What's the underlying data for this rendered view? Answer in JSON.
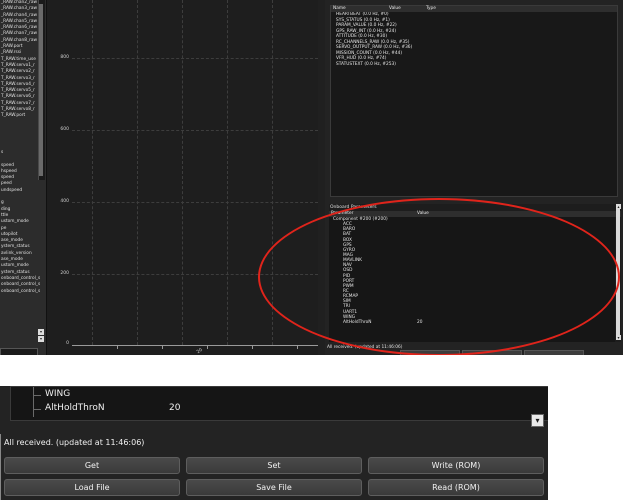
{
  "left_panel": {
    "items_top": [
      "_RAW.chan2_raw",
      "_RAW.chan3_raw",
      "_RAW.chan4_raw",
      "_RAW.chan5_raw",
      "_RAW.chan6_raw",
      "_RAW.chan7_raw",
      "_RAW.chan8_raw",
      "_RAW.port",
      "_RAW.rssi",
      "T_RAW.time_use",
      "T_RAW.servo1_r",
      "T_RAW.servo2_r",
      "T_RAW.servo3_r",
      "T_RAW.servo4_r",
      "T_RAW.servo5_r",
      "T_RAW.servo6_r",
      "T_RAW.servo7_r",
      "T_RAW.servo8_r",
      "T_RAW.port"
    ],
    "items_bottom": [
      "s",
      "",
      "speed",
      "hspeed",
      "speed",
      "peed",
      "undspeed",
      "",
      "g",
      "ding",
      "ttle",
      "ustom_mode",
      "pe",
      "utopilot",
      "ase_mode",
      "ystem_status",
      "avlink_version",
      "ase_mode",
      "ustom_mode",
      "ystem_status",
      "onboard_control_s",
      "onboard_control_s",
      "onboard_control_s"
    ]
  },
  "graph": {
    "y_ticks": [
      "800",
      "600",
      "400",
      "200",
      "0"
    ],
    "x_label": "20"
  },
  "monitor": {
    "columns": [
      "Name",
      "Value",
      "Type"
    ],
    "messages": [
      "HEARTBEAT (0.0 Hz, #0)",
      "SYS_STATUS (0.0 Hz, #1)",
      "PARAM_VALUE (0.0 Hz, #22)",
      "GPS_RAW_INT (0.0 Hz, #24)",
      "ATTITUDE (0.0 Hz, #30)",
      "RC_CHANNELS_RAW (0.0 Hz, #35)",
      "SERVO_OUTPUT_RAW (0.0 Hz, #36)",
      "MISSION_COUNT (0.0 Hz, #44)",
      "VFR_HUD (0.0 Hz, #74)",
      "STATUSTEXT (0.0 Hz, #253)"
    ]
  },
  "params": {
    "title": "Onboard Parameters",
    "columns": [
      "Parameter",
      "Value"
    ],
    "root": "Component #200 (#200)",
    "children": [
      "ACC",
      "BARO",
      "BAT",
      "BOX",
      "GPS",
      "GYRO",
      "MAG",
      "MAVLINK",
      "NAV",
      "OSD",
      "PID",
      "PORT",
      "PWM",
      "RC",
      "RCMAP",
      "SIM",
      "TRI",
      "UART1",
      "WING"
    ],
    "last_param": "AltHoldThroN",
    "last_value": "20",
    "status_small": "All received. (updated at 11:46:06)"
  },
  "zoom": {
    "row1": "WING",
    "row2": "AltHoldThroN",
    "row2_value": "20",
    "status": "All received. (updated at 11:46:06)",
    "buttons": {
      "get": "Get",
      "set": "Set",
      "write_rom": "Write (ROM)",
      "load_file": "Load File",
      "save_file": "Save File",
      "read_rom": "Read (ROM)"
    }
  },
  "colors": {
    "highlight_ellipse": "#e0241b",
    "background_dark": "#202020"
  }
}
